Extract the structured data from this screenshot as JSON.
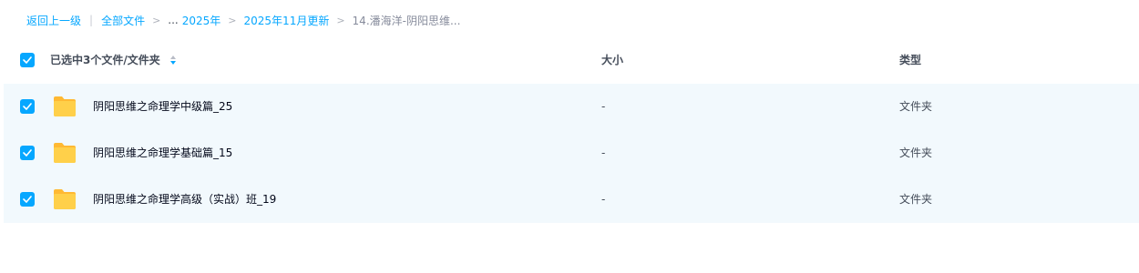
{
  "breadcrumb": {
    "back": "返回上一级",
    "all_files": "全部文件",
    "ellipsis": "...",
    "year": "2025年",
    "month": "2025年11月更新",
    "current": "14.潘海洋-阴阳思维..."
  },
  "header": {
    "selection_label": "已选中3个文件/文件夹",
    "size_label": "大小",
    "type_label": "类型"
  },
  "files": [
    {
      "name": "阴阳思维之命理学中级篇_25",
      "size": "-",
      "type": "文件夹",
      "checked": true
    },
    {
      "name": "阴阳思维之命理学基础篇_15",
      "size": "-",
      "type": "文件夹",
      "checked": true
    },
    {
      "name": "阴阳思维之命理学高级（实战）班_19",
      "size": "-",
      "type": "文件夹",
      "checked": true
    }
  ],
  "colors": {
    "accent": "#06a7ff",
    "row_selected_bg": "#f2f9fd",
    "folder_yellow": "#ffc933"
  },
  "icons": {
    "checkbox": "check-icon",
    "folder": "folder-icon",
    "sort": "sort-icon",
    "separator": "chevron-right-icon"
  }
}
